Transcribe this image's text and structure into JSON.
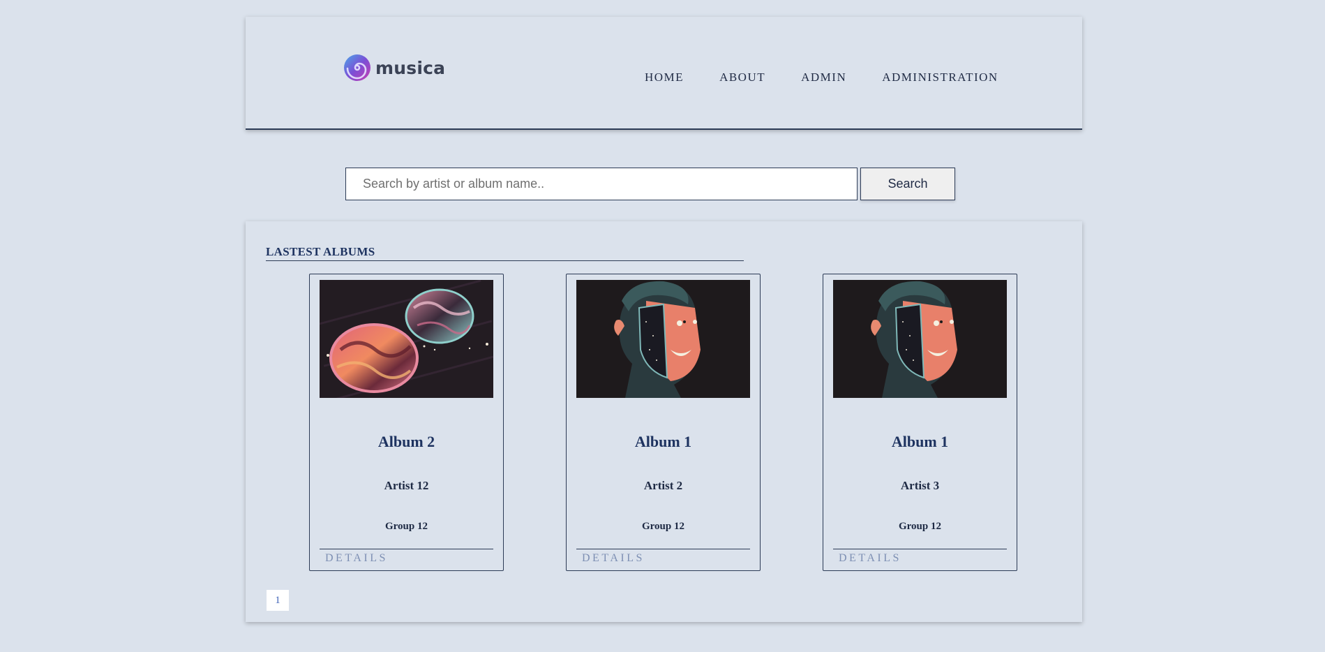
{
  "header": {
    "logo_text": "musica",
    "nav": [
      "HOME",
      "ABOUT",
      "ADMIN",
      "ADMINISTRATION"
    ]
  },
  "search": {
    "placeholder": "Search by artist or album name..",
    "value": "",
    "button_label": "Search"
  },
  "albums_section": {
    "title": "LASTEST ALBUMS",
    "cards": [
      {
        "title": "Album 2",
        "artist": "Artist 12",
        "group": "Group 12",
        "details_label": "DETAILS",
        "cover": "planets-artwork"
      },
      {
        "title": "Album 1",
        "artist": "Artist 2",
        "group": "Group 12",
        "details_label": "DETAILS",
        "cover": "mask-face-artwork"
      },
      {
        "title": "Album 1",
        "artist": "Artist 3",
        "group": "Group 12",
        "details_label": "DETAILS",
        "cover": "mask-face-artwork"
      }
    ]
  },
  "pagination": {
    "current_page": "1"
  },
  "colors": {
    "background": "#dbe2ec",
    "accent_text": "#1e3360",
    "details_link": "#7d8fb3",
    "border": "#2b3a55"
  }
}
